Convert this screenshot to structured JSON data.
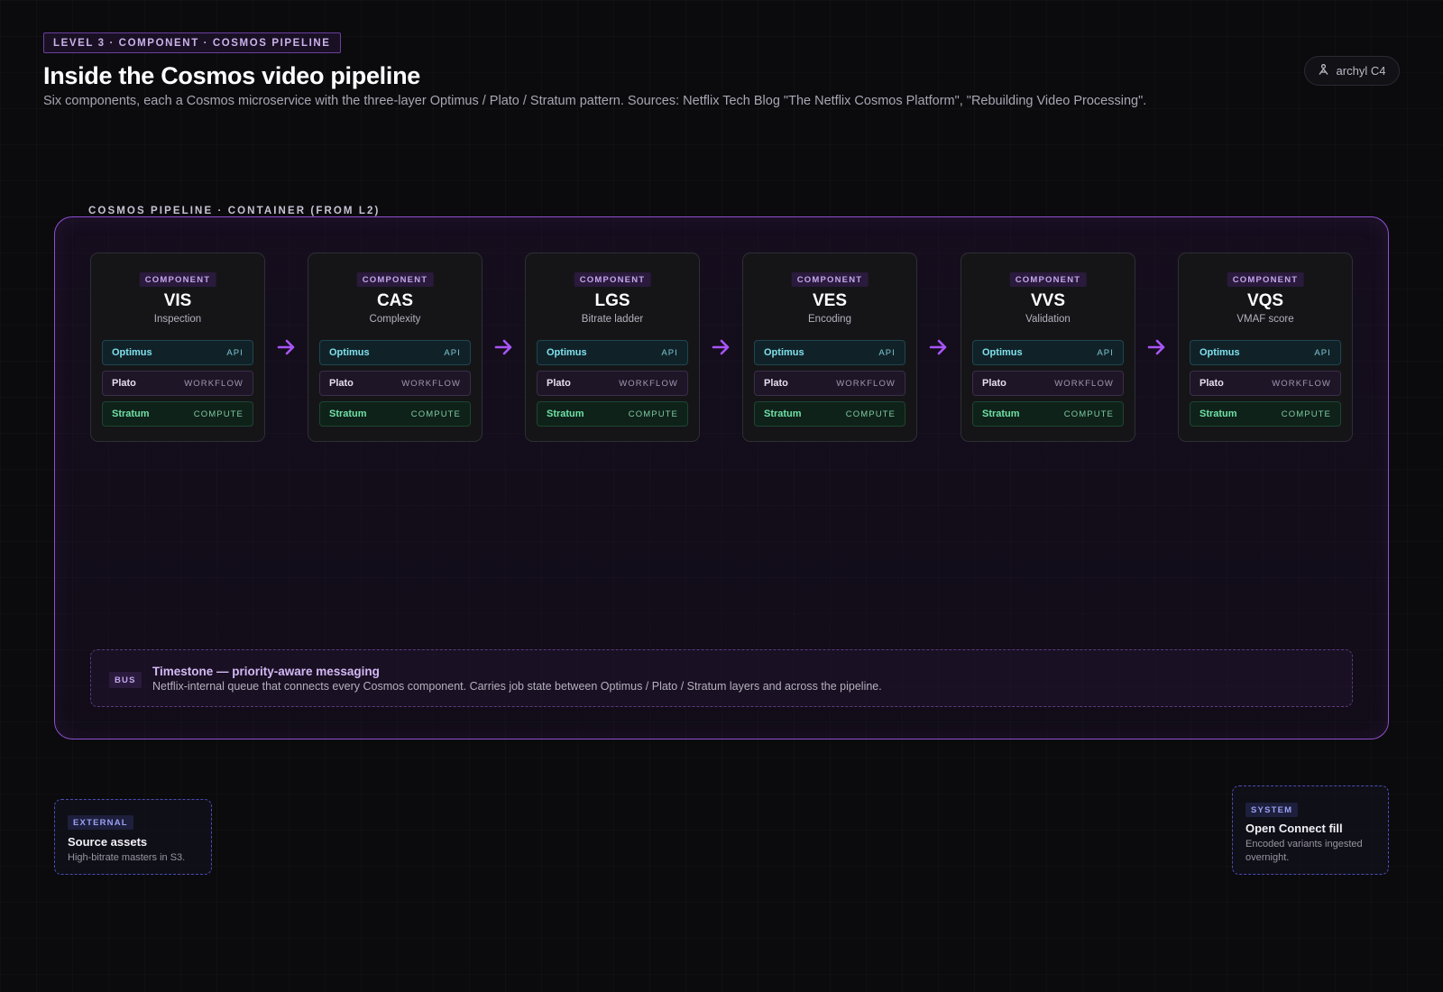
{
  "header": {
    "level_badge": "LEVEL 3 · COMPONENT · COSMOS PIPELINE",
    "title": "Inside the Cosmos video pipeline",
    "subtitle": "Six components, each a Cosmos microservice with the three-layer Optimus / Plato / Stratum pattern. Sources: Netflix Tech Blog \"The Netflix Cosmos Platform\", \"Rebuilding Video Processing\"."
  },
  "brand": {
    "label": "archyl C4",
    "icon": "person-icon"
  },
  "container": {
    "label": "COSMOS PIPELINE · CONTAINER (FROM L2)"
  },
  "components": [
    {
      "tag": "COMPONENT",
      "name": "VIS",
      "description": "Inspection",
      "layers": [
        {
          "name": "Optimus",
          "type": "API"
        },
        {
          "name": "Plato",
          "type": "WORKFLOW"
        },
        {
          "name": "Stratum",
          "type": "COMPUTE"
        }
      ]
    },
    {
      "tag": "COMPONENT",
      "name": "CAS",
      "description": "Complexity",
      "layers": [
        {
          "name": "Optimus",
          "type": "API"
        },
        {
          "name": "Plato",
          "type": "WORKFLOW"
        },
        {
          "name": "Stratum",
          "type": "COMPUTE"
        }
      ]
    },
    {
      "tag": "COMPONENT",
      "name": "LGS",
      "description": "Bitrate ladder",
      "layers": [
        {
          "name": "Optimus",
          "type": "API"
        },
        {
          "name": "Plato",
          "type": "WORKFLOW"
        },
        {
          "name": "Stratum",
          "type": "COMPUTE"
        }
      ]
    },
    {
      "tag": "COMPONENT",
      "name": "VES",
      "description": "Encoding",
      "layers": [
        {
          "name": "Optimus",
          "type": "API"
        },
        {
          "name": "Plato",
          "type": "WORKFLOW"
        },
        {
          "name": "Stratum",
          "type": "COMPUTE"
        }
      ]
    },
    {
      "tag": "COMPONENT",
      "name": "VVS",
      "description": "Validation",
      "layers": [
        {
          "name": "Optimus",
          "type": "API"
        },
        {
          "name": "Plato",
          "type": "WORKFLOW"
        },
        {
          "name": "Stratum",
          "type": "COMPUTE"
        }
      ]
    },
    {
      "tag": "COMPONENT",
      "name": "VQS",
      "description": "VMAF score",
      "layers": [
        {
          "name": "Optimus",
          "type": "API"
        },
        {
          "name": "Plato",
          "type": "WORKFLOW"
        },
        {
          "name": "Stratum",
          "type": "COMPUTE"
        }
      ]
    }
  ],
  "bus": {
    "tag": "BUS",
    "title": "Timestone — priority-aware messaging",
    "description": "Netflix-internal queue that connects every Cosmos component. Carries job state between Optimus / Plato / Stratum layers and across the pipeline."
  },
  "external": {
    "tag": "EXTERNAL",
    "title": "Source assets",
    "description": "High-bitrate masters in S3."
  },
  "system": {
    "tag": "SYSTEM",
    "title": "Open Connect fill",
    "description": "Encoded variants ingested overnight."
  },
  "colors": {
    "accent": "#a855f7",
    "container_border": "#8f4fd0",
    "api": "#7fe0ec",
    "compute": "#6fe0a7",
    "external_border": "#4a4cb8"
  }
}
